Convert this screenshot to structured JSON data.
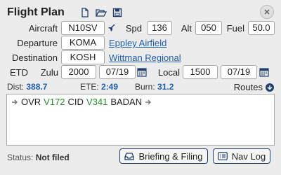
{
  "header": {
    "title": "Flight Plan",
    "icons": [
      "new-file-icon",
      "open-folder-icon",
      "save-icon",
      "close-icon"
    ]
  },
  "aircraft": {
    "label": "Aircraft",
    "value": "N10SV"
  },
  "speed": {
    "label": "Spd",
    "value": "136"
  },
  "altitude": {
    "label": "Alt",
    "value": "050"
  },
  "fuel": {
    "label": "Fuel",
    "value": "50.0"
  },
  "departure": {
    "label": "Departure",
    "value": "KOMA",
    "name": "Eppley Airfield"
  },
  "destination": {
    "label": "Destination",
    "value": "KOSH",
    "name": "Wittman Regional"
  },
  "etd": {
    "label": "ETD",
    "zulu_label": "Zulu",
    "zulu_time": "2000",
    "zulu_date": "07/19",
    "local_label": "Local",
    "local_time": "1500",
    "local_date": "07/19"
  },
  "stats": {
    "dist_label": "Dist:",
    "dist": "388.7",
    "ete_label": "ETE:",
    "ete": "2:49",
    "burn_label": "Burn:",
    "burn": "31.2",
    "routes_label": "Routes"
  },
  "route": {
    "items": [
      {
        "text": "OVR",
        "type": "fix"
      },
      {
        "text": "V172",
        "type": "airway"
      },
      {
        "text": "CID",
        "type": "fix"
      },
      {
        "text": "V341",
        "type": "airway"
      },
      {
        "text": "BADAN",
        "type": "fix"
      }
    ]
  },
  "status": {
    "label": "Status:",
    "value": "Not filed"
  },
  "buttons": {
    "briefing": "Briefing & Filing",
    "navlog": "Nav Log"
  },
  "colors": {
    "link": "#1f5fa8",
    "airway": "#2a8a2a",
    "accent": "#1f3f6a"
  }
}
